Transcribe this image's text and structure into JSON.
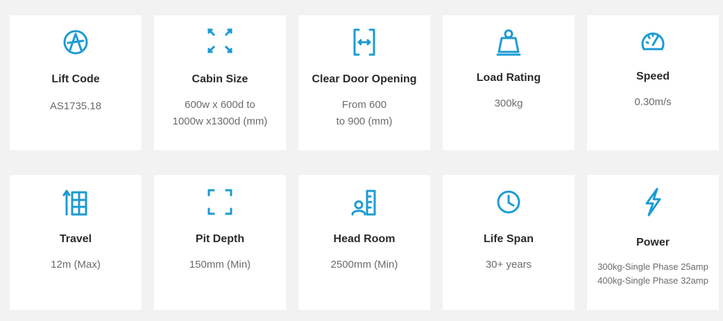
{
  "accent": "#1b9bd3",
  "cards": [
    {
      "icon": "accessibility-icon",
      "title": "Lift Code",
      "lines": [
        "AS1735.18"
      ]
    },
    {
      "icon": "expand-arrows-icon",
      "title": "Cabin Size",
      "lines": [
        "600w x 600d to",
        "1000w x1300d (mm)"
      ]
    },
    {
      "icon": "door-opening-icon",
      "title": "Clear Door Opening",
      "lines": [
        "From 600",
        "to 900 (mm)"
      ]
    },
    {
      "icon": "weight-icon",
      "title": "Load Rating",
      "lines": [
        "300kg"
      ]
    },
    {
      "icon": "speedometer-icon",
      "title": "Speed",
      "lines": [
        "0.30m/s"
      ]
    },
    {
      "icon": "travel-elevator-icon",
      "title": "Travel",
      "lines": [
        "12m (Max)"
      ]
    },
    {
      "icon": "pit-corners-icon",
      "title": "Pit Depth",
      "lines": [
        "150mm (Min)"
      ]
    },
    {
      "icon": "headroom-icon",
      "title": "Head Room",
      "lines": [
        "2500mm (Min)"
      ]
    },
    {
      "icon": "clock-icon",
      "title": "Life Span",
      "lines": [
        "30+ years"
      ]
    },
    {
      "icon": "lightning-icon",
      "title": "Power",
      "lines": [
        "300kg-Single Phase 25amp",
        "400kg-Single Phase 32amp"
      ]
    }
  ]
}
